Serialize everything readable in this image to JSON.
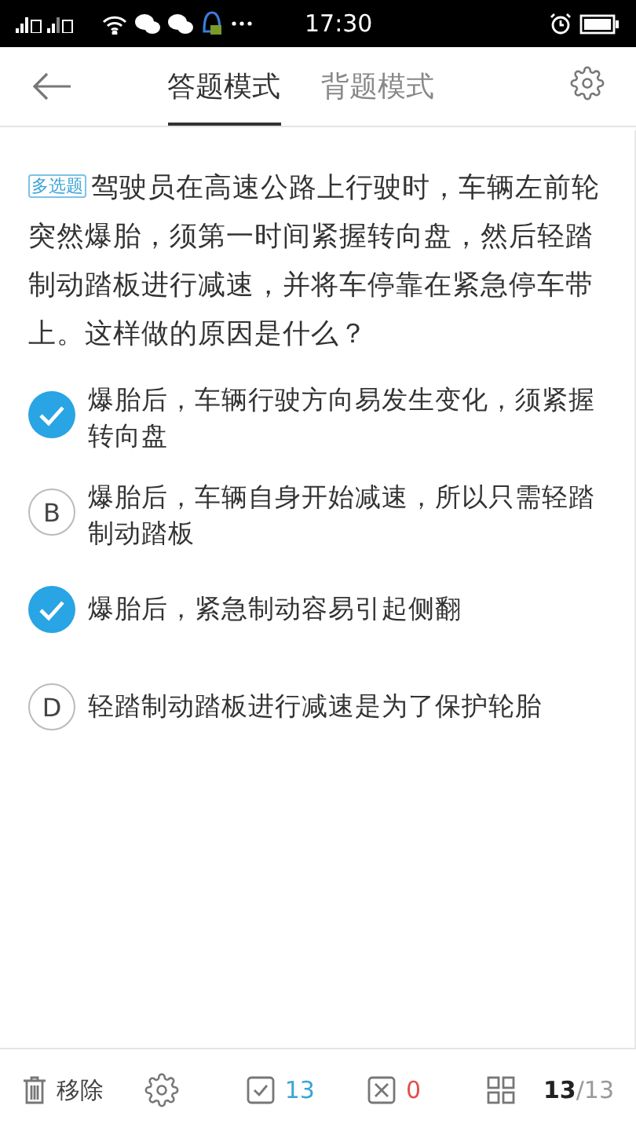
{
  "status_bar": {
    "time": "17:30"
  },
  "tabs": [
    {
      "label": "答题模式",
      "selected": true
    },
    {
      "label": "背题模式",
      "selected": false
    }
  ],
  "question": {
    "tag": "多选题",
    "text": "驾驶员在高速公路上行驶时，车辆左前轮突然爆胎，须第一时间紧握转向盘，然后轻踏制动踏板进行减速，并将车停靠在紧急停车带上。这样做的原因是什么？"
  },
  "options": [
    {
      "text": "爆胎后，车辆行驶方向易发生变化，须紧握转向盘",
      "selected": true
    },
    {
      "letter": "B",
      "text": "爆胎后，车辆自身开始减速，所以只需轻踏制动踏板",
      "selected": false
    },
    {
      "text": "爆胎后，紧急制动容易引起侧翻",
      "selected": true
    },
    {
      "letter": "D",
      "text": "轻踏制动踏板进行减速是为了保护轮胎",
      "selected": false
    }
  ],
  "bottom_bar": {
    "remove": "移除",
    "correct": "13",
    "wrong": "0",
    "current": "13",
    "total": "/13"
  }
}
